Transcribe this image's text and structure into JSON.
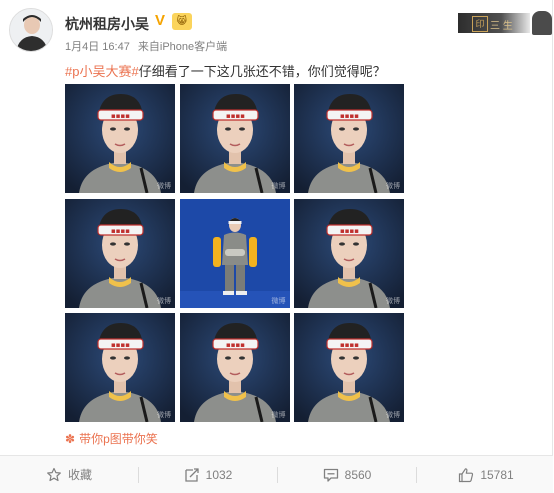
{
  "post": {
    "author": "杭州租房小吴",
    "badge_v": "V",
    "badge_brand": "😸",
    "date": "1月4日 16:47",
    "source_prefix": "来自",
    "source_client": "iPhone客户端",
    "topic": "#p小吴大赛#",
    "body": "仔细看了一下这几张还不错，你们觉得呢？",
    "repost_source": "带你p图带你笑",
    "photo_count": 9,
    "photo_watermark": "微博"
  },
  "promo": {
    "seal": "印",
    "title": "三 生"
  },
  "actions": {
    "favorite_label": "收藏",
    "repost_count": "1032",
    "comment_count": "8560",
    "like_count": "15781"
  },
  "icons": {
    "favorite": "star-outline-icon",
    "repost": "share-arrow-icon",
    "comment": "comment-bubble-icon",
    "like": "thumbs-up-icon",
    "source": "flower-icon"
  },
  "colors": {
    "link": "#eb7350",
    "muted": "#808080",
    "verified": "#f5a300",
    "photo_bg_blue": "#1f3352",
    "photo_bg_wall": "#1d49a8"
  }
}
